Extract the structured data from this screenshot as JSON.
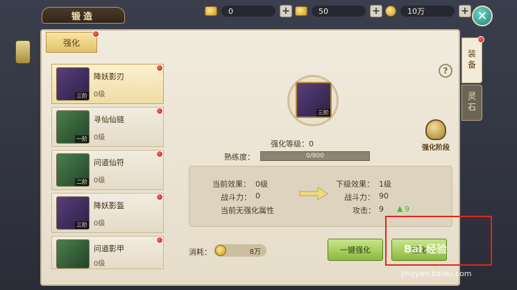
{
  "header": {
    "title": "锻造",
    "resources": [
      {
        "name": "gold-ingot",
        "value": "0"
      },
      {
        "name": "bound-ingot",
        "value": "50"
      },
      {
        "name": "coins",
        "value": "10万"
      }
    ],
    "plus_label": "+",
    "close_label": "✕"
  },
  "tab": {
    "label": "强化"
  },
  "side_tabs": {
    "equipment": "装备",
    "spirit_stone": "灵石"
  },
  "items": [
    {
      "name": "降妖影刃",
      "level": "0级",
      "tier": "三阶"
    },
    {
      "name": "寻仙仙链",
      "level": "0级",
      "tier": "一阶"
    },
    {
      "name": "问道仙符",
      "level": "0级",
      "tier": "二阶"
    },
    {
      "name": "降妖影盔",
      "level": "0级",
      "tier": "三阶"
    },
    {
      "name": "问道影甲",
      "level": "0级",
      "tier": ""
    }
  ],
  "center": {
    "tier": "三阶"
  },
  "stage_badge": "强化阶段",
  "help_label": "?",
  "strength_level": "强化等级：0",
  "proficiency": {
    "label": "熟练度：",
    "value": "0/800"
  },
  "stats": {
    "current_effect_label": "当前效果：",
    "current_effect": "0级",
    "current_power_label": "战斗力：",
    "current_power": "0",
    "no_attr": "当前无强化属性",
    "next_effect_label": "下级效果：",
    "next_effect": "1级",
    "next_power_label": "战斗力：",
    "next_power": "90",
    "attack_label": "攻击：",
    "attack": "9",
    "attack_gain": "9"
  },
  "cost": {
    "label": "消耗：",
    "value": "8万"
  },
  "buttons": {
    "one_click": "一键强化",
    "strengthen": "强化"
  },
  "watermark": {
    "text": "Bai 经验",
    "sub": "jingyan.baidu.com"
  }
}
